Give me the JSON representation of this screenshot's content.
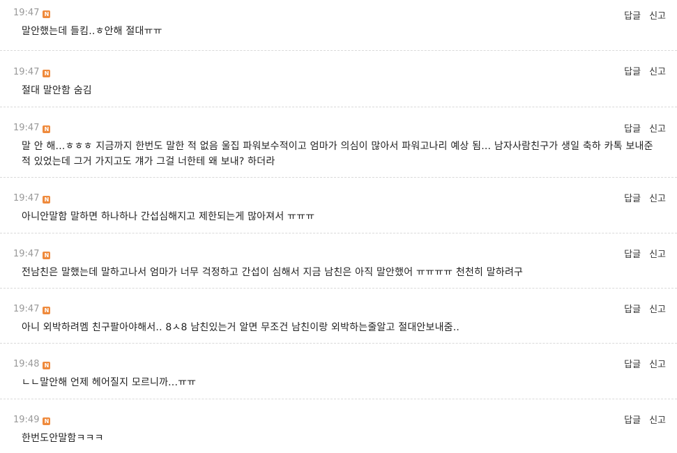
{
  "colors": {
    "badge": "#ef8a3c",
    "time": "#999999",
    "text": "#222222",
    "divider": "#d9d9d9"
  },
  "labels": {
    "reply": "답글",
    "report": "신고",
    "badge": "N"
  },
  "comments": [
    {
      "time": "19:47",
      "text": "말안했는데 들킴..ㅎ안해 절대ㅠㅠ"
    },
    {
      "time": "19:47",
      "text": "절대 말안함 숨김"
    },
    {
      "time": "19:47",
      "text": "말 안 해...ㅎㅎㅎ 지금까지 한번도 말한 적 없음 울집 파워보수적이고 엄마가 의심이 많아서 파워고나리 예상 됨... 남자사람친구가 생일 축하 카톡 보내준 적 있었는데 그거 가지고도 걔가 그걸 너한테 왜 보내? 하더라"
    },
    {
      "time": "19:47",
      "text": "아니안말함 말하면 하나하나 간섭심해지고 제한되는게 많아져서 ㅠㅠㅠ"
    },
    {
      "time": "19:47",
      "text": "전남친은 말했는데 말하고나서 엄마가 너무 걱정하고 간섭이 심해서 지금 남친은 아직 말안했어 ㅠㅠㅠㅠ 천천히 말하려구"
    },
    {
      "time": "19:47",
      "text": "아니 외박하려멤 친구팔아야해서.. 8ㅅ8 남친있는거 알면 무조건 남친이랑 외박하는줄알고 절대안보내줌.."
    },
    {
      "time": "19:48",
      "text": "ㄴㄴ말안해 언제 헤어질지 모르니까...ㅠㅠ"
    },
    {
      "time": "19:49",
      "text": "한번도안말함ㅋㅋㅋ"
    }
  ]
}
